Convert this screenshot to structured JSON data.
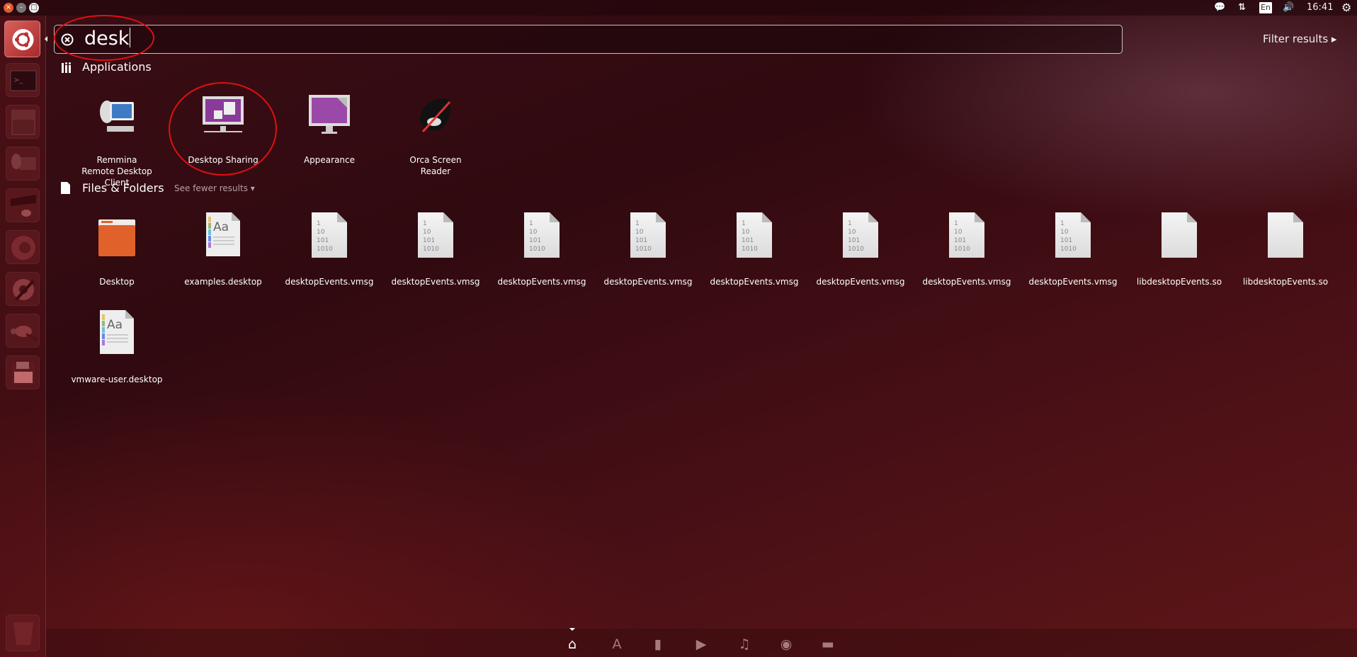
{
  "window_controls": {
    "close": "×",
    "minimize": "–",
    "maximize": "□"
  },
  "tray": {
    "time": "16:41",
    "keyboard": "En",
    "icons": [
      "chat-icon",
      "network-icon",
      "keyboard-layout-icon",
      "volume-icon",
      "power-gear-icon"
    ]
  },
  "search": {
    "value": "desk",
    "filter_label": "Filter results ▸"
  },
  "applications": {
    "header": "Applications",
    "items": [
      {
        "label": "Remmina Remote Desktop Client",
        "icon": "remmina-icon"
      },
      {
        "label": "Desktop Sharing",
        "icon": "desktop-sharing-icon"
      },
      {
        "label": "Appearance",
        "icon": "appearance-icon"
      },
      {
        "label": "Orca Screen Reader",
        "icon": "orca-icon"
      }
    ]
  },
  "files": {
    "header": "Files & Folders",
    "see_fewer": "See fewer results ▾",
    "items": [
      {
        "label": "Desktop",
        "icon": "folder"
      },
      {
        "label": "examples.desktop",
        "icon": "text"
      },
      {
        "label": "desktopEvents.vmsg",
        "icon": "binary"
      },
      {
        "label": "desktopEvents.vmsg",
        "icon": "binary"
      },
      {
        "label": "desktopEvents.vmsg",
        "icon": "binary"
      },
      {
        "label": "desktopEvents.vmsg",
        "icon": "binary"
      },
      {
        "label": "desktopEvents.vmsg",
        "icon": "binary"
      },
      {
        "label": "desktopEvents.vmsg",
        "icon": "binary"
      },
      {
        "label": "desktopEvents.vmsg",
        "icon": "binary"
      },
      {
        "label": "desktopEvents.vmsg",
        "icon": "binary"
      },
      {
        "label": "libdesktopEvents.so",
        "icon": "blank"
      },
      {
        "label": "libdesktopEvents.so",
        "icon": "blank"
      },
      {
        "label": "vmware-user.desktop",
        "icon": "text"
      }
    ]
  },
  "binary_glyph": [
    "1",
    "10",
    "101",
    "1010"
  ],
  "launcher": [
    "ubuntu-dash",
    "terminal",
    "files",
    "remmina",
    "libreoffice-impress",
    "firefox",
    "system-settings",
    "gimp",
    "save"
  ],
  "lenses": [
    "home",
    "applications",
    "files",
    "video",
    "music",
    "photos",
    "social"
  ],
  "colors": {
    "annotation": "#e01010",
    "folder": "#e0622a"
  }
}
